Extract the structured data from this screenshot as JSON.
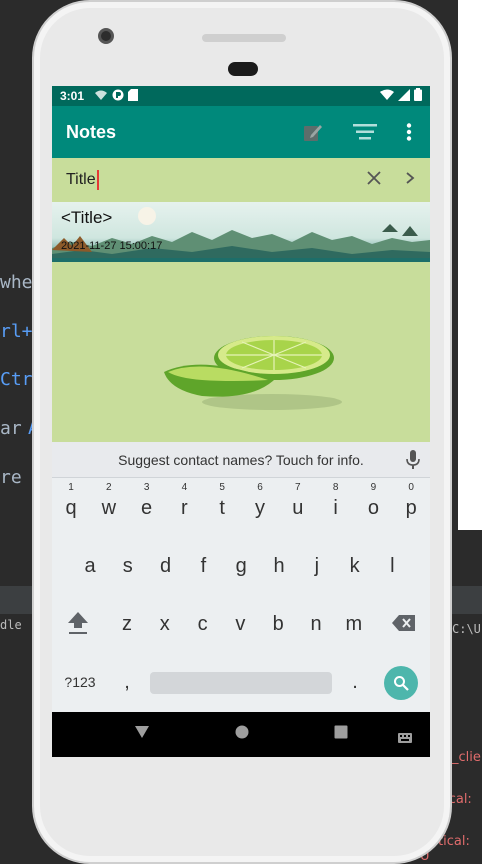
{
  "background": {
    "text_fragments": [
      "whe",
      "rl+S",
      "Ctrl",
      "ar",
      "A",
      "re to",
      "dle",
      "C:\\U",
      "_clier",
      "tical: U",
      "Critical: U"
    ]
  },
  "status_bar": {
    "time": "3:01"
  },
  "app_bar": {
    "title": "Notes",
    "actions": [
      "new-note-icon",
      "sort-icon",
      "more-vert-icon"
    ]
  },
  "search": {
    "value": "Title"
  },
  "note": {
    "title": "<Title>",
    "date": "2021-11-27 15:00:17"
  },
  "keyboard": {
    "suggestion": "Suggest contact names? Touch for info.",
    "row1": [
      {
        "k": "q",
        "n": "1"
      },
      {
        "k": "w",
        "n": "2"
      },
      {
        "k": "e",
        "n": "3"
      },
      {
        "k": "r",
        "n": "4"
      },
      {
        "k": "t",
        "n": "5"
      },
      {
        "k": "y",
        "n": "6"
      },
      {
        "k": "u",
        "n": "7"
      },
      {
        "k": "i",
        "n": "8"
      },
      {
        "k": "o",
        "n": "9"
      },
      {
        "k": "p",
        "n": "0"
      }
    ],
    "row2": [
      "a",
      "s",
      "d",
      "f",
      "g",
      "h",
      "j",
      "k",
      "l"
    ],
    "row3": [
      "z",
      "x",
      "c",
      "v",
      "b",
      "n",
      "m"
    ],
    "symbols_label": "?123",
    "comma": ",",
    "period": "."
  },
  "colors": {
    "status_bar": "#00695c",
    "app_bar": "#00897b",
    "content_bg": "#c8dd9b",
    "accent": "#4db6ac"
  }
}
